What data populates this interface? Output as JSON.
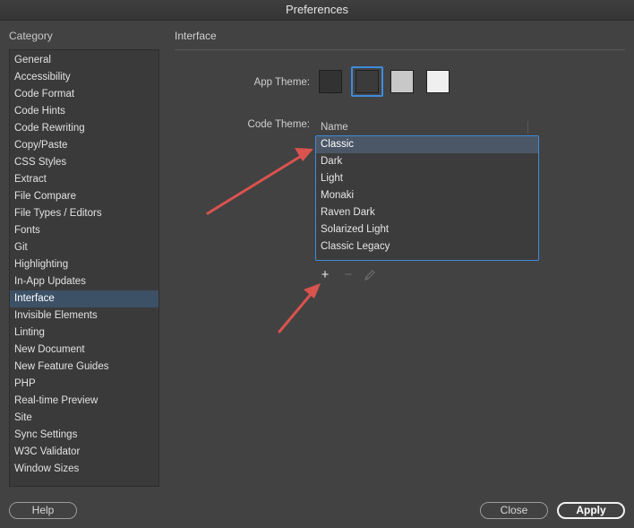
{
  "window": {
    "title": "Preferences"
  },
  "sidebar": {
    "heading": "Category",
    "items": [
      {
        "label": "General"
      },
      {
        "label": "Accessibility"
      },
      {
        "label": "Code Format"
      },
      {
        "label": "Code Hints"
      },
      {
        "label": "Code Rewriting"
      },
      {
        "label": "Copy/Paste"
      },
      {
        "label": "CSS Styles"
      },
      {
        "label": "Extract"
      },
      {
        "label": "File Compare"
      },
      {
        "label": "File Types / Editors"
      },
      {
        "label": "Fonts"
      },
      {
        "label": "Git"
      },
      {
        "label": "Highlighting"
      },
      {
        "label": "In-App Updates"
      },
      {
        "label": "Interface"
      },
      {
        "label": "Invisible Elements"
      },
      {
        "label": "Linting"
      },
      {
        "label": "New Document"
      },
      {
        "label": "New Feature Guides"
      },
      {
        "label": "PHP"
      },
      {
        "label": "Real-time Preview"
      },
      {
        "label": "Site"
      },
      {
        "label": "Sync Settings"
      },
      {
        "label": "W3C Validator"
      },
      {
        "label": "Window Sizes"
      }
    ],
    "selected": "Interface"
  },
  "main": {
    "title": "Interface",
    "app_theme": {
      "label": "App Theme:",
      "swatches": [
        {
          "color": "#323232"
        },
        {
          "color": "#3b3b3b"
        },
        {
          "color": "#c8c8c8"
        },
        {
          "color": "#efefef"
        }
      ],
      "selected_index": 1
    },
    "code_theme": {
      "label": "Code Theme:",
      "column_header": "Name",
      "themes": [
        "Classic",
        "Dark",
        "Light",
        "Monaki",
        "Raven Dark",
        "Solarized Light",
        "Classic Legacy"
      ],
      "selected": "Classic"
    },
    "tools": {
      "add": "+",
      "remove": "−"
    }
  },
  "footer": {
    "help": "Help",
    "close": "Close",
    "apply": "Apply"
  },
  "colors": {
    "accent": "#3f8bdc",
    "annotation_arrow": "#d9534f"
  }
}
